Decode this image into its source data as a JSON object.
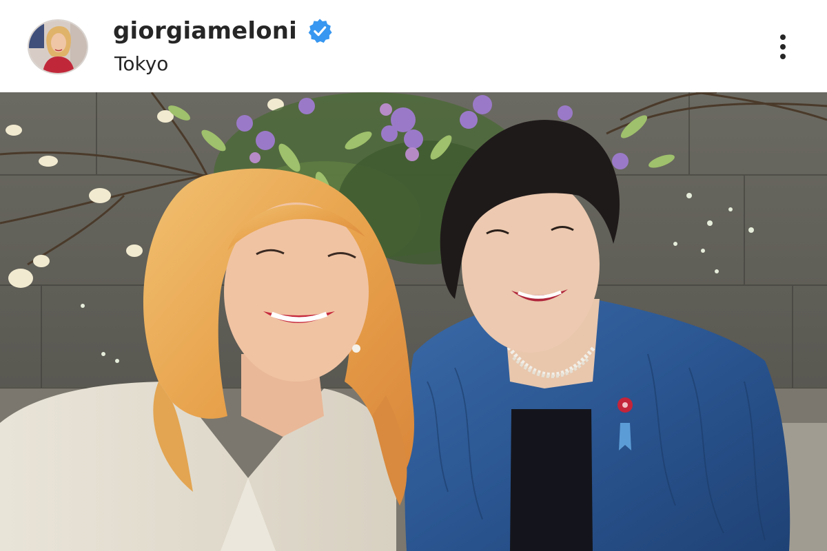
{
  "header": {
    "username": "giorgiameloni",
    "location": "Tokyo",
    "verified": true,
    "verified_icon": "verified-badge-icon",
    "more_icon": "more-options-icon",
    "avatar_icon": "profile-avatar"
  },
  "colors": {
    "verified_blue": "#3897f0",
    "text_primary": "#262626",
    "background": "#ffffff"
  }
}
